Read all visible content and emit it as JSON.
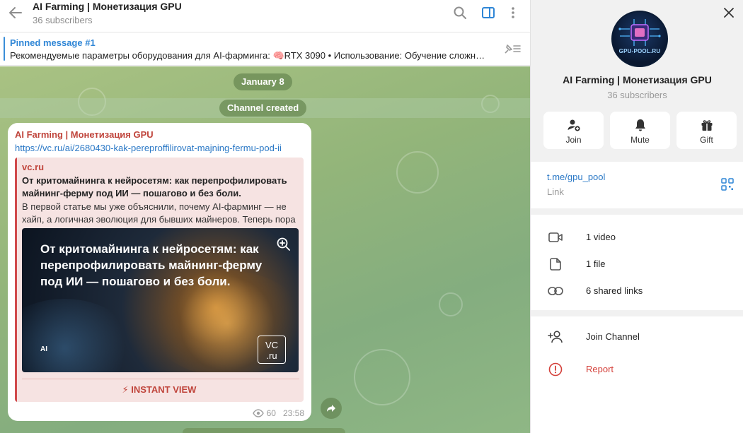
{
  "chat": {
    "title": "AI Farming | Монетизация GPU",
    "subscribers": "36 subscribers",
    "pinned_title": "Pinned message #1",
    "pinned_text": "Рекомендуемые параметры оборудования для AI-фарминга: 🧠RTX 3090      • Использование: Обучение сложных моделей"
  },
  "feed": {
    "date": "January 8",
    "service": "Channel created"
  },
  "message": {
    "author": "AI Farming | Монетизация GPU",
    "link": "https://vc.ru/ai/2680430-kak-pereproffilirovat-majning-fermu-pod-ii",
    "preview": {
      "site": "vc.ru",
      "title": "От критомайнинга к нейросетям: как перепрофилировать майнинг-ферму под ИИ — пошагово и без боли.",
      "description": "В первой статье мы уже объяснили, почему AI-фарминг — не хайп, а логичная эволюция для бывших майнеров. Теперь пора перейти к практике.",
      "image_text": "От критомайнинга к нейросетям: как перепрофилировать майнинг-ферму под ИИ — пошагово и без боли.",
      "image_tag": "AI",
      "image_logo_top": "VC",
      "image_logo_bottom": ".ru",
      "instant_view": "⚡ INSTANT VIEW"
    },
    "views": "60",
    "time": "23:58"
  },
  "panel": {
    "avatar_text": "GPU-POOL.RU",
    "name": "AI Farming | Монетизация GPU",
    "subscribers": "36 subscribers",
    "actions": [
      {
        "label": "Join",
        "icon": "add-user-icon"
      },
      {
        "label": "Mute",
        "icon": "bell-icon"
      },
      {
        "label": "Gift",
        "icon": "gift-icon"
      }
    ],
    "link": "t.me/gpu_pool",
    "link_label": "Link",
    "media": [
      {
        "label": "1 video",
        "icon": "video-icon"
      },
      {
        "label": "1 file",
        "icon": "file-icon"
      },
      {
        "label": "6 shared links",
        "icon": "link-icon"
      }
    ],
    "join_channel": "Join Channel",
    "report": "Report"
  },
  "colors": {
    "accent_blue": "#2f86d6",
    "author_red": "#c0453c",
    "report_red": "#d4403a",
    "chat_bg": "#93b57a"
  }
}
